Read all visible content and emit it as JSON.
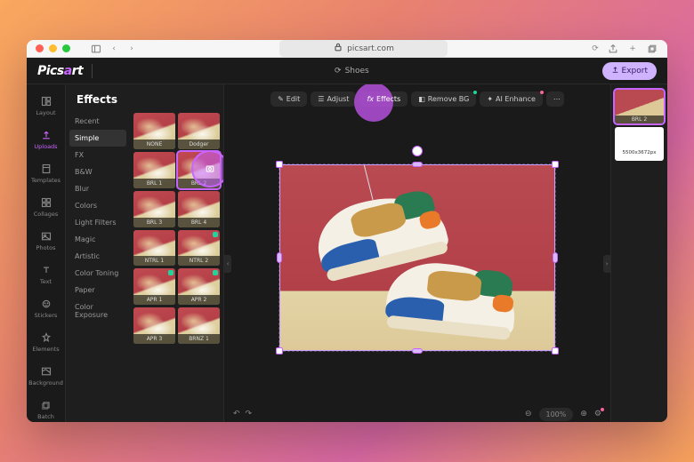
{
  "browser": {
    "url": "picsart.com"
  },
  "app": {
    "logo": "Picsart",
    "file_name": "Shoes",
    "export_label": "Export"
  },
  "rail": [
    {
      "label": "Layout"
    },
    {
      "label": "Uploads"
    },
    {
      "label": "Templates"
    },
    {
      "label": "Collages"
    },
    {
      "label": "Photos"
    },
    {
      "label": "Text"
    },
    {
      "label": "Stickers"
    },
    {
      "label": "Elements"
    },
    {
      "label": "Background"
    },
    {
      "label": "Batch"
    }
  ],
  "effects": {
    "title": "Effects",
    "categories": [
      "Recent",
      "Simple",
      "FX",
      "B&W",
      "Blur",
      "Colors",
      "Light Filters",
      "Magic",
      "Artistic",
      "Color Toning",
      "Paper",
      "Color Exposure"
    ],
    "thumbs": [
      {
        "label": "NONE"
      },
      {
        "label": "Dodger"
      },
      {
        "label": "BRL 1"
      },
      {
        "label": "BRL 2",
        "selected": true
      },
      {
        "label": "BRL 3"
      },
      {
        "label": "BRL 4"
      },
      {
        "label": "NTRL 1"
      },
      {
        "label": "NTRL 2",
        "badge": true
      },
      {
        "label": "APR 1",
        "badge": true
      },
      {
        "label": "APR 2",
        "badge": true
      },
      {
        "label": "APR 3"
      },
      {
        "label": "BRNZ 1"
      }
    ]
  },
  "tooltabs": {
    "edit": "Edit",
    "adjust": "Adjust",
    "effects": "Effects",
    "removebg": "Remove BG",
    "aienhance": "AI Enhance"
  },
  "zoom": "100%",
  "layers": {
    "active_label": "BRL 2",
    "canvas_dim": "5500x3672px"
  }
}
